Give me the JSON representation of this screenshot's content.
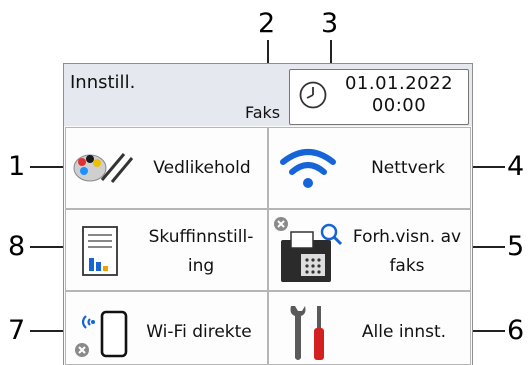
{
  "callouts": [
    "1",
    "2",
    "3",
    "4",
    "5",
    "6",
    "7",
    "8"
  ],
  "header": {
    "title": "Innstill.",
    "mode": "Faks",
    "date": "01.01.2022",
    "time": "00:00"
  },
  "tiles": [
    {
      "label": "Vedlikehold",
      "icon": "ink-brush-icon"
    },
    {
      "label": "Nettverk",
      "icon": "wifi-icon"
    },
    {
      "label_line1": "Skuffinnstill-",
      "label_line2": "ing",
      "icon": "tray-settings-icon"
    },
    {
      "label_line1": "Forh.visn. av",
      "label_line2": "faks",
      "icon": "fax-preview-icon"
    },
    {
      "label": "Wi-Fi direkte",
      "icon": "wifi-direct-icon"
    },
    {
      "label": "Alle innst.",
      "icon": "tools-icon"
    }
  ],
  "colors": {
    "header_bg": "#e6e8ef",
    "wifi_blue": "#1565d8",
    "tool_red": "#d32020"
  }
}
